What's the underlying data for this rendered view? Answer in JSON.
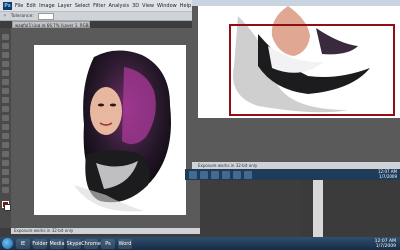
{
  "photoshop": {
    "logo": "Ps",
    "menu": [
      "File",
      "Edit",
      "Image",
      "Layer",
      "Select",
      "Filter",
      "Analysis",
      "3D",
      "View",
      "Window",
      "Help"
    ],
    "options": {
      "label": "Tolerance:"
    },
    "doc_tab": "waqfa(1).jpg @ 66.7% (Layer 1, RGB/8*) *",
    "status": "Exposure works in 32-bit only"
  },
  "right_window": {
    "status": "Exposure works in 32-bit only",
    "clock": {
      "time": "12:07 AM",
      "date": "1/7/2009"
    }
  },
  "taskbar": {
    "buttons": [
      "IE",
      "Folder",
      "Media",
      "Skype",
      "Chrome",
      "Ps",
      "Word"
    ],
    "clock": {
      "time": "12:07 AM",
      "date": "1/7/2009"
    }
  },
  "colors": {
    "selection_rect": "#8f0f12",
    "foreground_swatch": "#8c1010"
  }
}
